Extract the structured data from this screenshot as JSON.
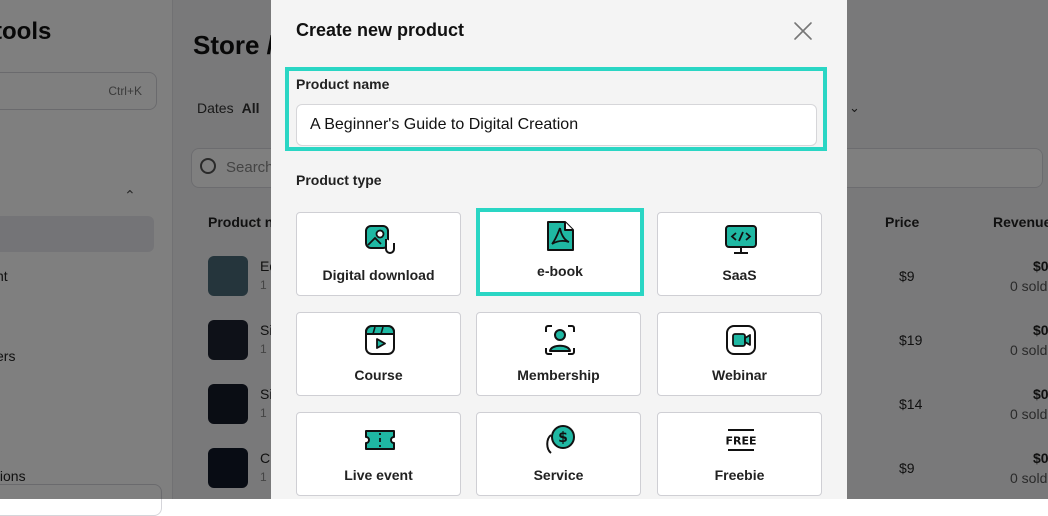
{
  "background": {
    "brand": "tools",
    "search_shortcut": "Ctrl+K",
    "sidebar_texts": [
      "nt",
      "ers",
      "tions"
    ],
    "page_title": "Store /",
    "filters": {
      "dates": "Dates",
      "all": "All"
    },
    "search_placeholder": "Search",
    "table_headers": {
      "product": "Product n",
      "price": "Price",
      "revenue": "Revenue"
    },
    "rows": [
      {
        "name": "Ed",
        "sub": "1",
        "price": "$9",
        "revenue": "$0",
        "sold": "0 sold"
      },
      {
        "name": "Si",
        "sub": "1",
        "price": "$19",
        "revenue": "$0",
        "sold": "0 sold"
      },
      {
        "name": "Si",
        "sub": "1",
        "price": "$14",
        "revenue": "$0",
        "sold": "0 sold"
      },
      {
        "name": "Cr",
        "sub": "1",
        "price": "$9",
        "revenue": "$0",
        "sold": "0 sold"
      }
    ]
  },
  "modal": {
    "title": "Create new product",
    "product_name_label": "Product name",
    "product_name_value": "A Beginner's Guide to Digital Creation",
    "product_type_label": "Product type",
    "types": [
      {
        "label": "Digital download",
        "icon": "digital-download-icon"
      },
      {
        "label": "e-book",
        "icon": "pdf-icon",
        "selected": true
      },
      {
        "label": "SaaS",
        "icon": "monitor-code-icon"
      },
      {
        "label": "Course",
        "icon": "video-course-icon"
      },
      {
        "label": "Membership",
        "icon": "membership-icon"
      },
      {
        "label": "Webinar",
        "icon": "camera-icon"
      },
      {
        "label": "Live event",
        "icon": "ticket-icon"
      },
      {
        "label": "Service",
        "icon": "dollar-coin-icon"
      },
      {
        "label": "Freebie",
        "icon": "free-tag-icon"
      }
    ]
  },
  "colors": {
    "accent": "#2ad6c4",
    "icon_fill": "#1fb8a3",
    "overlay": "#000000"
  }
}
